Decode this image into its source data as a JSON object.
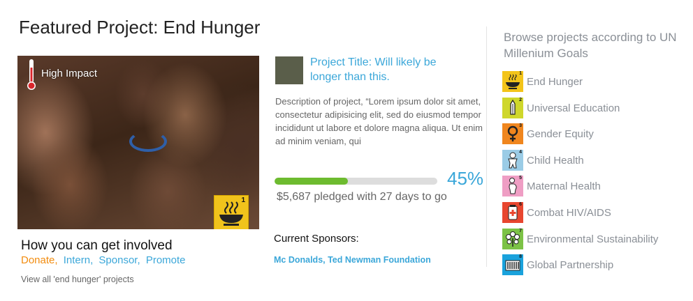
{
  "page": {
    "title": "Featured Project: End Hunger"
  },
  "featured": {
    "impact_label": "High Impact",
    "goal_tile_number": "1"
  },
  "involve": {
    "heading": "How you can get involved",
    "links": {
      "donate": "Donate,",
      "intern": "Intern,",
      "sponsor": "Sponsor,",
      "promote": "Promote"
    },
    "view_all": "View all 'end hunger' projects"
  },
  "project": {
    "title": "Project Title: Will likely be longer than this.",
    "description": "Description of project, “Lorem ipsum dolor sit amet, consectetur adipisicing elit, sed do eiusmod tempor incididunt ut labore et dolore magna aliqua. Ut enim ad minim veniam, qui",
    "progress_fraction": 0.45,
    "percent_label": "45%",
    "pledge_text": "$5,687 pledged with 27 days to go",
    "sponsors_label": "Current Sponsors:",
    "sponsors": "Mc Donalds, Ted Newman Foundation"
  },
  "browse": {
    "heading": "Browse projects according to UN Millenium Goals",
    "goals": [
      {
        "label": "End Hunger",
        "number": "1",
        "color": "#f3c41a",
        "icon": "bowl-icon"
      },
      {
        "label": "Universal Education",
        "number": "2",
        "color": "#cfd72b",
        "icon": "pencil-icon"
      },
      {
        "label": "Gender Equity",
        "number": "3",
        "color": "#f0861e",
        "icon": "female-symbol-icon"
      },
      {
        "label": "Child Health",
        "number": "4",
        "color": "#9bcce6",
        "icon": "child-icon"
      },
      {
        "label": "Maternal Health",
        "number": "5",
        "color": "#ef9ec4",
        "icon": "mother-icon"
      },
      {
        "label": "Combat HIV/AIDS",
        "number": "6",
        "color": "#e8462f",
        "icon": "medicine-icon"
      },
      {
        "label": "Environmental Sustainability",
        "number": "7",
        "color": "#7cc246",
        "icon": "plant-icon"
      },
      {
        "label": "Global Partnership",
        "number": "8",
        "color": "#1aa2dc",
        "icon": "people-group-icon"
      }
    ]
  },
  "colors": {
    "accent_blue": "#3ba7d9",
    "accent_orange": "#f28c0f",
    "progress_green": "#6dbb2f"
  }
}
